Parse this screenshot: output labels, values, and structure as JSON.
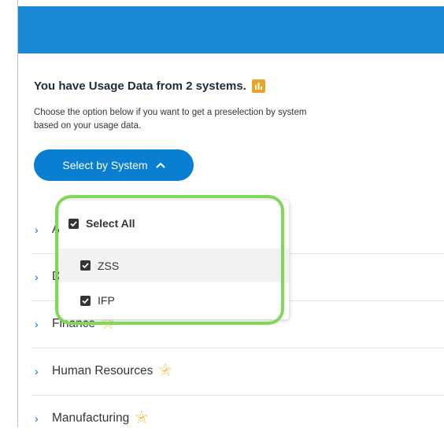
{
  "header": {
    "color": "#1a88d4"
  },
  "usage": {
    "title": "You have Usage Data from 2 systems.",
    "description": "Choose the option below if you want to get a preselection by system based on your usage data.",
    "select_button_label": "Select by System"
  },
  "dropdown": {
    "select_all_label": "Select All",
    "options": [
      {
        "label": "ZSS",
        "checked": true
      },
      {
        "label": "IFP",
        "checked": true
      }
    ]
  },
  "categories": [
    {
      "label": "A"
    },
    {
      "label": "D"
    },
    {
      "label": "Finance"
    },
    {
      "label": "Human Resources"
    },
    {
      "label": "Manufacturing"
    }
  ],
  "colors": {
    "accent": "#0a7fd1",
    "highlight": "#7ed957",
    "usage_icon": "#e9a426"
  }
}
